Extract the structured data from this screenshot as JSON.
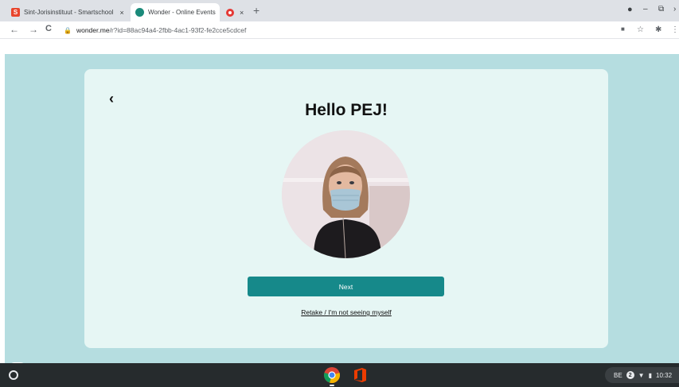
{
  "browser": {
    "tabs": [
      {
        "title": "Sint-Jorisinstituut - Smartschool",
        "favicon": "smartschool-icon",
        "favicon_letter": "S",
        "close": "×"
      },
      {
        "title": "Wonder - Online Events",
        "favicon": "wonder-icon"
      },
      {
        "title": "",
        "favicon": "recording-icon",
        "close": "×"
      }
    ],
    "new_tab": "+",
    "window_controls": {
      "profile": "●",
      "minimize": "–",
      "restore": "⧉",
      "close": "›"
    },
    "nav": {
      "back": "←",
      "forward": "→",
      "reload": "C"
    },
    "url_host": "wonder.me",
    "url_path": "/r?id=88ac94a4-2fbb-4ac1-93f2-fe2cce5cdcef",
    "toolbar_icons": {
      "camera": "■",
      "star": "☆",
      "extensions": "✱",
      "menu": "⋮"
    }
  },
  "page": {
    "back_glyph": "‹",
    "greeting": "Hello PEJ!",
    "next_label": "Next",
    "retake_label": "Retake / I'm not seeing myself"
  },
  "shelf": {
    "keyboard": "BE",
    "notifications": "2",
    "wifi": "▼",
    "battery": "▮",
    "time": "10:32"
  },
  "colors": {
    "accent": "#16898a",
    "background": "#b5dde0",
    "card": "#e6f6f4",
    "shelf": "#262b2d"
  }
}
